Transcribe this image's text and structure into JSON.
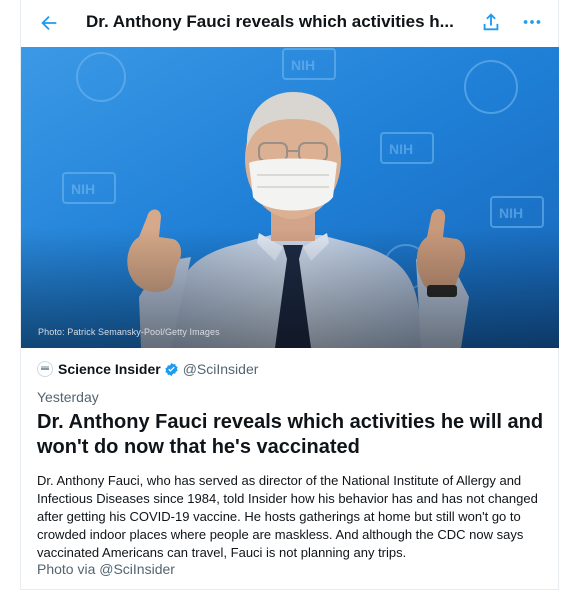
{
  "header": {
    "title": "Dr. Anthony Fauci reveals which activities h...",
    "back_icon": "arrow-left-icon",
    "share_icon": "share-icon",
    "more_icon": "more-horizontal-icon"
  },
  "hero": {
    "photo_credit": "Photo: Patrick Semansky-Pool/Getty Images"
  },
  "source": {
    "name": "Science Insider",
    "handle": "@SciInsider",
    "verified": true
  },
  "article": {
    "date": "Yesterday",
    "headline": "Dr. Anthony Fauci reveals which activities he will and won't do now that he's vaccinated",
    "summary": "Dr. Anthony Fauci, who has served as director of the National Institute of Allergy and Infectious Diseases since 1984, told Insider how his behavior has and has not changed after getting his COVID-19 vaccine. He hosts gatherings at home but still won't go to crowded indoor places where people are maskless. And although the CDC now says vaccinated Americans can travel, Fauci is not planning any trips.",
    "photo_via": "Photo via @SciInsider"
  },
  "colors": {
    "accent": "#1d9bf0",
    "secondary_text": "#536471",
    "backdrop_blue": "#1f7fd6"
  }
}
